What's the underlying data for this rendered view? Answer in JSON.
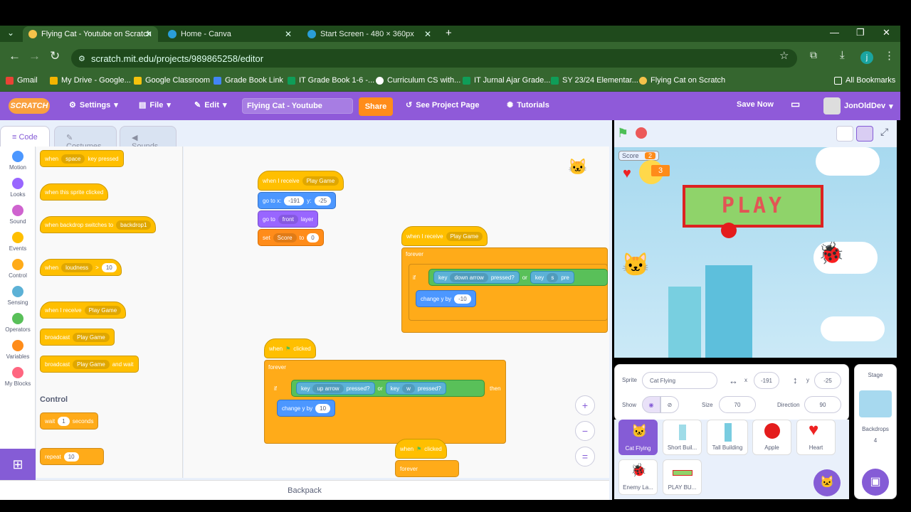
{
  "browser": {
    "tabs": [
      {
        "label": "Flying Cat - Youtube on Scratch"
      },
      {
        "label": "Home - Canva"
      },
      {
        "label": "Start Screen - 480 × 360px"
      }
    ],
    "url": "scratch.mit.edu/projects/989865258/editor",
    "bookmarks": [
      "Gmail",
      "My Drive - Google...",
      "Google Classroom",
      "Grade Book Link",
      "IT Grade Book 1-6 -...",
      "Curriculum CS with...",
      "IT Jurnal Ajar Grade...",
      "SY 23/24 Elementar...",
      "Flying Cat on Scratch"
    ],
    "all_bookmarks": "All Bookmarks",
    "profile_initial": "j"
  },
  "menu": {
    "logo": "SCRATCH",
    "settings": "Settings",
    "file": "File",
    "edit": "Edit",
    "project_title": "Flying Cat - Youtube",
    "share": "Share",
    "see_project": "See Project Page",
    "tutorials": "Tutorials",
    "save_now": "Save Now",
    "user": "JonOldDev"
  },
  "editor_tabs": {
    "code": "Code",
    "costumes": "Costumes",
    "sounds": "Sounds"
  },
  "categories": [
    {
      "label": "Motion",
      "color": "#4c97ff"
    },
    {
      "label": "Looks",
      "color": "#9966ff"
    },
    {
      "label": "Sound",
      "color": "#cf63cf"
    },
    {
      "label": "Events",
      "color": "#ffbf00"
    },
    {
      "label": "Control",
      "color": "#ffab19"
    },
    {
      "label": "Sensing",
      "color": "#5cb1d6"
    },
    {
      "label": "Operators",
      "color": "#59c059"
    },
    {
      "label": "Variables",
      "color": "#ff8c1a"
    },
    {
      "label": "My Blocks",
      "color": "#ff6680"
    }
  ],
  "palette": {
    "when_key": "when",
    "space": "space",
    "key_pressed": "key pressed",
    "sprite_clicked": "when this sprite clicked",
    "backdrop_switches": "when backdrop switches to",
    "backdrop1": "backdrop1",
    "when": "when",
    "loudness": "loudness",
    "gt": ">",
    "ten": "10",
    "when_receive": "when I receive",
    "play_game": "Play Game",
    "broadcast": "broadcast",
    "broadcast_wait": "broadcast",
    "and_wait": "and wait",
    "control_heading": "Control",
    "wait": "wait",
    "one": "1",
    "seconds": "seconds",
    "repeat": "repeat",
    "repeat_n": "10"
  },
  "scripts": {
    "s1": {
      "hat": "when I receive",
      "msg": "Play Game",
      "goto": "go to x:",
      "x": "-191",
      "y_lbl": "y:",
      "y": "-25",
      "goto_front": "go to",
      "front": "front",
      "layer": "layer",
      "set": "set",
      "var": "Score",
      "to": "to",
      "zero": "0"
    },
    "s2": {
      "hat": "when I receive",
      "msg": "Play Game",
      "forever": "forever",
      "if": "if",
      "key": "key",
      "down": "down arrow",
      "pressed": "pressed?",
      "or": "or",
      "key2": "key",
      "s": "s",
      "pressed2": "pre",
      "change": "change y by",
      "val": "-10"
    },
    "s3": {
      "hat": "when",
      "clicked": "clicked",
      "forever": "forever",
      "if": "if",
      "key": "key",
      "up": "up arrow",
      "pressed": "pressed?",
      "or": "or",
      "key2": "key",
      "w": "w",
      "pressed2": "pressed?",
      "then": "then",
      "change": "change y by",
      "val": "10"
    },
    "s4": {
      "hat": "when",
      "clicked": "clicked",
      "forever": "forever"
    }
  },
  "backpack": "Backpack",
  "stage": {
    "score_label": "Score",
    "score_value": "2",
    "lives_value": "3",
    "play_text": "PLAY"
  },
  "sprite_info": {
    "sprite_label": "Sprite",
    "sprite_name": "Cat Flying",
    "x_label": "x",
    "x": "-191",
    "y_label": "y",
    "y": "-25",
    "show_label": "Show",
    "size_label": "Size",
    "size": "70",
    "direction_label": "Direction",
    "direction": "90"
  },
  "sprites": [
    "Cat Flying",
    "Short Buil...",
    "Tall Building",
    "Apple",
    "Heart",
    "Enemy La...",
    "PLAY BU..."
  ],
  "stage_panel": {
    "label": "Stage",
    "backdrops_label": "Backdrops",
    "backdrops_count": "4"
  }
}
